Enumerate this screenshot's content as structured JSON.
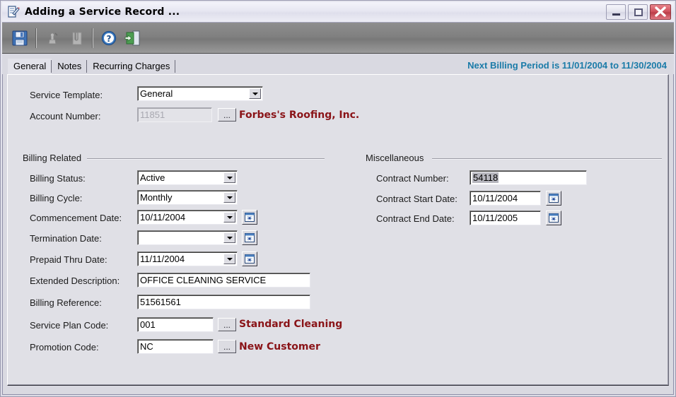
{
  "window": {
    "title": "Adding a Service Record ...",
    "icon": "document-pen-icon",
    "buttons": {
      "minimize": "minimize-button",
      "maximize": "maximize-button",
      "close": "close-button"
    }
  },
  "toolbar": {
    "items": [
      {
        "name": "save-button",
        "icon": "floppy-disk-icon",
        "enabled": true
      },
      {
        "name": "approve-button",
        "icon": "stamp-icon",
        "enabled": false
      },
      {
        "name": "attachment-button",
        "icon": "paperclip-note-icon",
        "enabled": false
      },
      {
        "name": "help-button",
        "icon": "question-mark-icon",
        "enabled": true
      },
      {
        "name": "exit-button",
        "icon": "exit-door-icon",
        "enabled": true
      }
    ]
  },
  "tabs": [
    {
      "label": "General",
      "active": true
    },
    {
      "label": "Notes",
      "active": false
    },
    {
      "label": "Recurring Charges",
      "active": false
    }
  ],
  "billing_note": "Next Billing Period is 11/01/2004 to 11/30/2004",
  "header_fields": {
    "service_template_label": "Service Template:",
    "service_template_value": "General",
    "account_number_label": "Account Number:",
    "account_number_value": "11851",
    "account_browse_label": "...",
    "customer_name": "Forbes's Roofing, Inc."
  },
  "billing_related": {
    "group_title": "Billing Related",
    "billing_status_label": "Billing Status:",
    "billing_status_value": "Active",
    "billing_cycle_label": "Billing Cycle:",
    "billing_cycle_value": "Monthly",
    "commencement_date_label": "Commencement Date:",
    "commencement_date_value": "10/11/2004",
    "termination_date_label": "Termination Date:",
    "termination_date_value": "",
    "prepaid_thru_date_label": "Prepaid Thru Date:",
    "prepaid_thru_date_value": "11/11/2004",
    "extended_description_label": "Extended Description:",
    "extended_description_value": "OFFICE CLEANING SERVICE",
    "billing_reference_label": "Billing Reference:",
    "billing_reference_value": "51561561",
    "service_plan_code_label": "Service Plan Code:",
    "service_plan_code_value": "001",
    "service_plan_browse_label": "...",
    "service_plan_name": "Standard Cleaning",
    "promotion_code_label": "Promotion Code:",
    "promotion_code_value": "NC",
    "promotion_browse_label": "...",
    "promotion_name": "New Customer"
  },
  "miscellaneous": {
    "group_title": "Miscellaneous",
    "contract_number_label": "Contract Number:",
    "contract_number_value": "54118",
    "contract_start_date_label": "Contract Start Date:",
    "contract_start_date_value": "10/11/2004",
    "contract_end_date_label": "Contract End Date:",
    "contract_end_date_value": "10/11/2005"
  },
  "colors": {
    "accent_red": "#8a1418",
    "accent_teal": "#1a7ba8",
    "panel_bg": "#e0e0e6",
    "toolbar_bg": "#808080"
  }
}
